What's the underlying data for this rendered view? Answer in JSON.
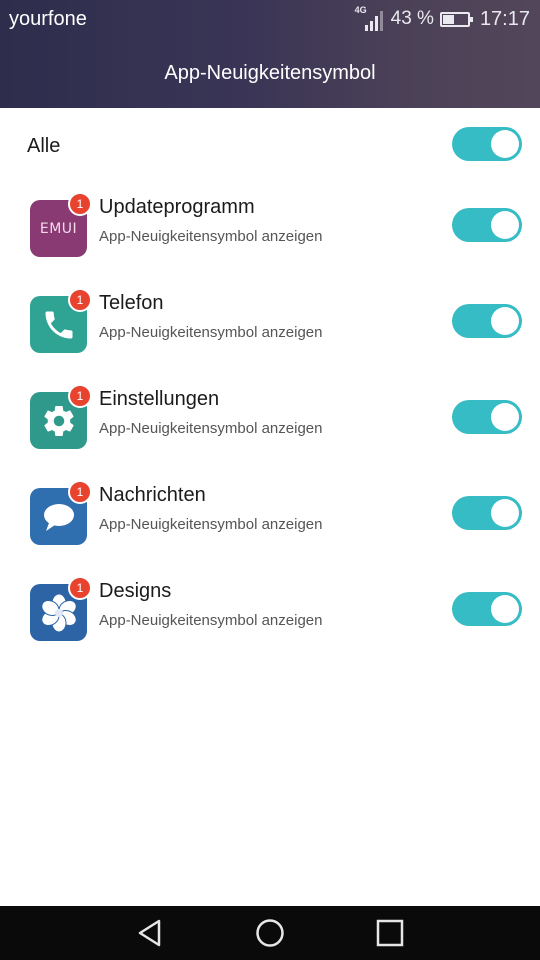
{
  "status_bar": {
    "carrier": "yourfone",
    "network_type": "4G",
    "battery_percent": "43 %",
    "battery_level": 0.43,
    "time": "17:17"
  },
  "header": {
    "title": "App-Neuigkeitensymbol"
  },
  "all_toggle": {
    "label": "Alle",
    "enabled": true
  },
  "apps": [
    {
      "name": "Updateprogramm",
      "subtitle": "App-Neuigkeitensymbol anzeigen",
      "badge": "1",
      "enabled": true,
      "icon": "emui-icon",
      "icon_text": "EMUI",
      "icon_color": "#8a3a72"
    },
    {
      "name": "Telefon",
      "subtitle": "App-Neuigkeitensymbol anzeigen",
      "badge": "1",
      "enabled": true,
      "icon": "phone-icon",
      "icon_color": "#2fa394"
    },
    {
      "name": "Einstellungen",
      "subtitle": "App-Neuigkeitensymbol anzeigen",
      "badge": "1",
      "enabled": true,
      "icon": "gear-icon",
      "icon_color": "#2f9a8c"
    },
    {
      "name": "Nachrichten",
      "subtitle": "App-Neuigkeitensymbol anzeigen",
      "badge": "1",
      "enabled": true,
      "icon": "chat-bubble-icon",
      "icon_color": "#2f6fb0"
    },
    {
      "name": "Designs",
      "subtitle": "App-Neuigkeitensymbol anzeigen",
      "badge": "1",
      "enabled": true,
      "icon": "themes-flower-icon",
      "icon_color": "#2d64a6"
    }
  ],
  "nav_bar": {
    "back": "back-icon",
    "home": "home-icon",
    "recents": "recents-icon"
  },
  "colors": {
    "accent": "#35bcc4",
    "badge": "#e8432e",
    "header_bg": "#3a3556"
  }
}
